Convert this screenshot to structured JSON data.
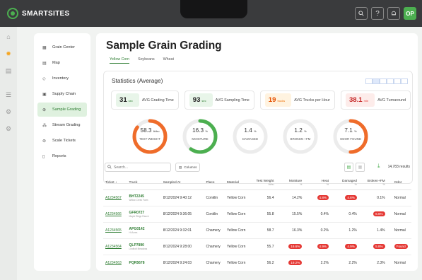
{
  "app": {
    "brand": "SMARTSITES",
    "avatar": "OP",
    "top_icons": [
      "search-icon",
      "help-icon",
      "bell-icon"
    ]
  },
  "rail": {
    "icons": [
      "home-icon",
      "sun-icon",
      "chart-icon",
      "list-icon",
      "gear-icon",
      "settings-icon"
    ]
  },
  "nav": {
    "items": [
      {
        "label": "Grain Center",
        "icon": "grid-icon"
      },
      {
        "label": "Map",
        "icon": "map-icon"
      },
      {
        "label": "Inventory",
        "icon": "inventory-icon"
      },
      {
        "label": "Supply Chain",
        "icon": "supply-chain-icon"
      },
      {
        "label": "Sample Grading",
        "icon": "sample-grading-icon"
      },
      {
        "label": "Stream Grading",
        "icon": "stream-grading-icon"
      },
      {
        "label": "Scale Tickets",
        "icon": "scale-ticket-icon"
      },
      {
        "label": "Reports",
        "icon": "reports-icon"
      }
    ],
    "active_index": 4
  },
  "page": {
    "title": "Sample Grain Grading",
    "tabs": [
      "Yellow Corn",
      "Soybeans",
      "Wheat"
    ],
    "active_tab": 0
  },
  "stats": {
    "title": "Statistics (Average)",
    "kpis": [
      {
        "value": "31",
        "unit": "sec",
        "label": "AVG Grading Time",
        "color": "#e8f5e9",
        "unit_color": "#2e7d32"
      },
      {
        "value": "93",
        "unit": "sec",
        "label": "AVG Sampling Time",
        "color": "#e8f5e9",
        "unit_color": "#2e7d32"
      },
      {
        "value": "19",
        "unit": "trucks",
        "label": "AVG Trucks per Hour",
        "color": "#fff3e0",
        "unit_color": "#ef6c00"
      },
      {
        "value": "38.1",
        "unit": "min",
        "label": "AVG Turnaround",
        "color": "#fdecea",
        "unit_color": "#e53935"
      }
    ],
    "donuts": [
      {
        "value": "58.3",
        "unit": "lb/bu",
        "label": "TEST WEIGHT",
        "level": 0.85,
        "color": "#ef6c2a"
      },
      {
        "value": "16.3",
        "unit": "%",
        "label": "MOISTURE",
        "level": 0.6,
        "color": "#4caf50"
      },
      {
        "value": "1.4",
        "unit": "%",
        "label": "DAMAGED",
        "level": 0.0,
        "color": "#4caf50"
      },
      {
        "value": "1.2",
        "unit": "%",
        "label": "BROKEN +FM",
        "level": 0.0,
        "color": "#4caf50"
      },
      {
        "value": "7.1",
        "unit": "%",
        "label": "ODOR FOUND",
        "level": 0.5,
        "color": "#ef6c2a"
      }
    ]
  },
  "toolbar": {
    "search_placeholder": "Search...",
    "columns_label": "Columns",
    "results": "14,783 results"
  },
  "table": {
    "headers": [
      {
        "label": "Ticket",
        "sub": ""
      },
      {
        "label": "Truck",
        "sub": ""
      },
      {
        "label": "Sampled At",
        "sub": ""
      },
      {
        "label": "Place",
        "sub": ""
      },
      {
        "label": "Material",
        "sub": ""
      },
      {
        "label": "Test Weight",
        "sub": "lb/bu"
      },
      {
        "label": "Moisture",
        "sub": "%"
      },
      {
        "label": "Heat",
        "sub": "%"
      },
      {
        "label": "Damaged",
        "sub": "%"
      },
      {
        "label": "Broken+FM",
        "sub": "%"
      },
      {
        "label": "Odor",
        "sub": ""
      }
    ],
    "rows": [
      {
        "ticket": "A1234567",
        "truck": "BHT2245",
        "truck_sub": "Willow Creek Farm",
        "sampled": "8/12/2024 9:40:12",
        "place": "Conklin",
        "material": "Yellow Corn",
        "tw": "56.4",
        "moisture": "14.2%",
        "heat": "4.8%",
        "damaged": "4.8%",
        "broken": "0.1%",
        "odor": "Normal",
        "flags": {
          "heat": true,
          "damaged": true
        }
      },
      {
        "ticket": "A1234566",
        "truck": "GFR0727",
        "truck_sub": "Maple Ridge Ranch",
        "sampled": "8/12/2024 9:36:05",
        "place": "Conklin",
        "material": "Yellow Corn",
        "tw": "55.8",
        "moisture": "15.5%",
        "heat": "0.4%",
        "damaged": "0.4%",
        "broken": "6.6%",
        "odor": "Normal",
        "flags": {
          "broken": true
        }
      },
      {
        "ticket": "A1234565",
        "truck": "APG0142",
        "truck_sub": "Hi Acres",
        "sampled": "8/12/2024 9:32:01",
        "place": "Chamery",
        "material": "Yellow Corn",
        "tw": "58.7",
        "moisture": "16.3%",
        "heat": "0.2%",
        "damaged": "1.2%",
        "broken": "1.4%",
        "odor": "Normal",
        "flags": {}
      },
      {
        "ticket": "A1234564",
        "truck": "QLP7890",
        "truck_sub": "Lindholt Meadows",
        "sampled": "8/12/2024 9:28:00",
        "place": "Chamery",
        "material": "Yellow Corn",
        "tw": "55.7",
        "moisture": "16.6%",
        "heat": "4.9%",
        "damaged": "4.9%",
        "broken": "5.8%",
        "odor": "Found",
        "flags": {
          "moisture": true,
          "heat": true,
          "damaged": true,
          "broken": true,
          "odor": true
        }
      },
      {
        "ticket": "A1234563",
        "truck": "PQR5678",
        "truck_sub": "",
        "sampled": "8/12/2024 9:24:03",
        "place": "Chamery",
        "material": "Yellow Corn",
        "tw": "56.2",
        "moisture": "19.2%",
        "heat": "2.2%",
        "damaged": "2.2%",
        "broken": "2.3%",
        "odor": "Normal",
        "flags": {
          "moisture": true
        }
      }
    ]
  }
}
